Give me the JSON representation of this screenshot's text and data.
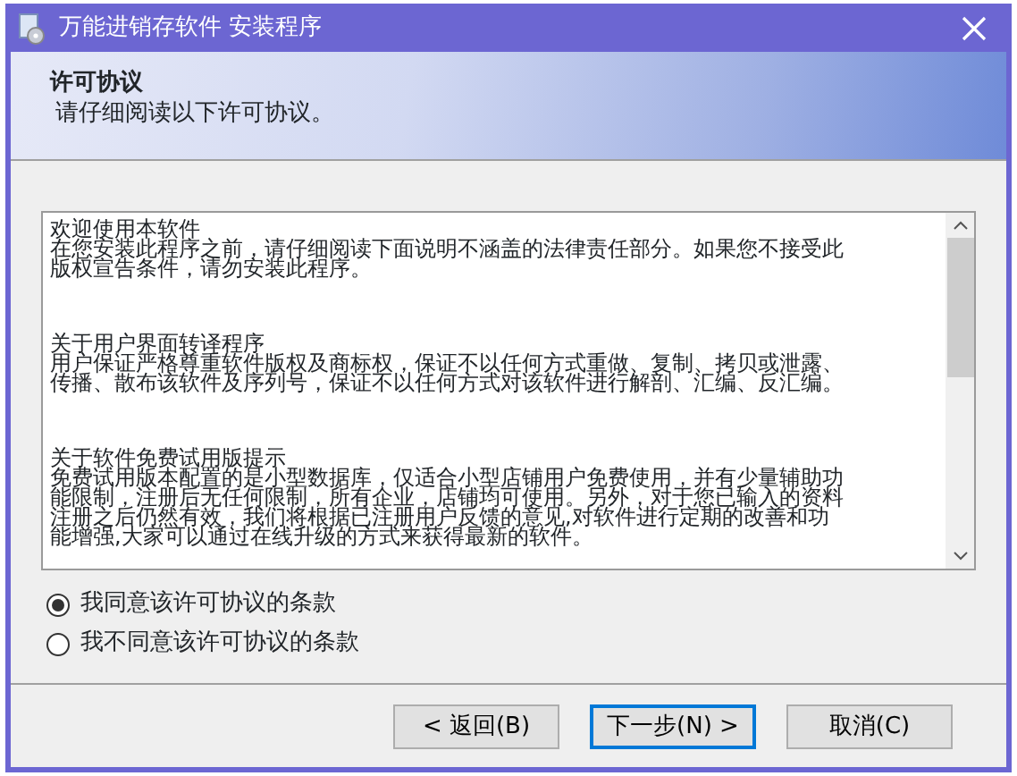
{
  "window": {
    "title": "万能进销存软件 安装程序"
  },
  "header": {
    "title": "许可协议",
    "subtitle": "请仔细阅读以下许可协议。"
  },
  "license_text": [
    {
      "lines": [
        "欢迎使用本软件",
        "在您安装此程序之前，请仔细阅读下面说明不涵盖的法律责任部分。如果您不接受此",
        "版权宣告条件，请勿安装此程序。"
      ]
    },
    {
      "lines": [
        "关于用户界面转译程序",
        "用户保证严格尊重软件版权及商标权，保证不以任何方式重做、复制、拷贝或泄露、",
        "传播、散布该软件及序列号，保证不以任何方式对该软件进行解剖、汇编、反汇编。"
      ]
    },
    {
      "lines": [
        "关于软件免费试用版提示",
        "免费试用版本配置的是小型数据库，仅适合小型店铺用户免费使用，并有少量辅助功",
        "能限制，注册后无任何限制，所有企业，店铺均可使用。另外，对于您已输入的资料",
        "注册之后仍然有效，我们将根据已注册用户反馈的意见,对软件进行定期的改善和功",
        "能增强,大家可以通过在线升级的方式来获得最新的软件。"
      ]
    }
  ],
  "options": [
    {
      "label": "我同意该许可协议的条款",
      "selected": true
    },
    {
      "label": "我不同意该许可协议的条款",
      "selected": false
    }
  ],
  "buttons": [
    {
      "label": "< 返回(B)",
      "default": false
    },
    {
      "label": "下一步(N) >",
      "default": true
    },
    {
      "label": "取消(C)",
      "default": false
    }
  ]
}
